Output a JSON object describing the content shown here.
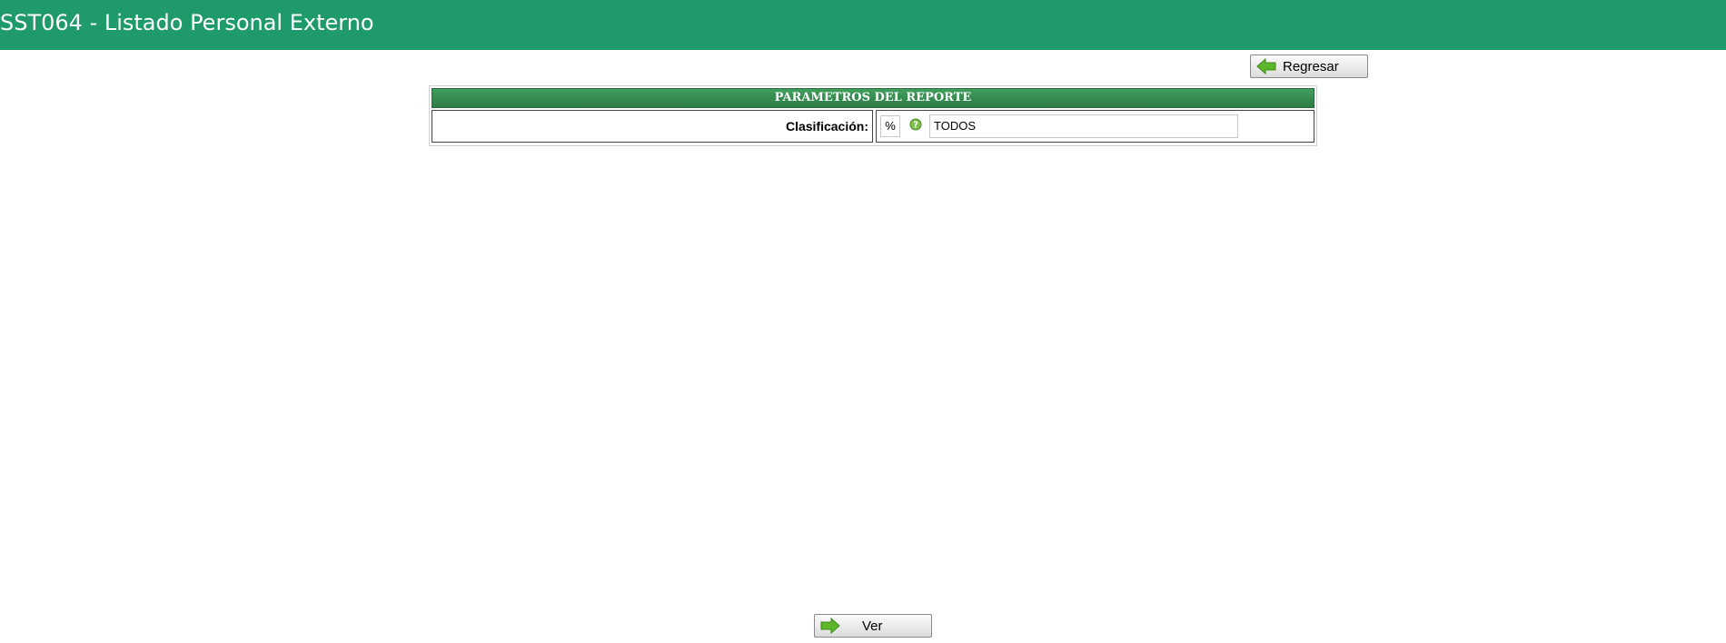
{
  "header": {
    "title": "SST064 - Listado Personal Externo"
  },
  "toolbar": {
    "back_label": "Regresar",
    "back_icon": "arrow-left-icon"
  },
  "report": {
    "section_title": "PARAMETROS DEL REPORTE",
    "fields": {
      "clasificacion": {
        "label": "Clasificación:",
        "code_value": "%",
        "description_value": "TODOS",
        "help_icon": "help-icon"
      }
    }
  },
  "footer": {
    "view_label": "Ver",
    "view_icon": "arrow-right-icon"
  },
  "colors": {
    "topbar": "#1e9a6b",
    "section_header": "#2e7c45",
    "arrow": "#5cb82a"
  }
}
